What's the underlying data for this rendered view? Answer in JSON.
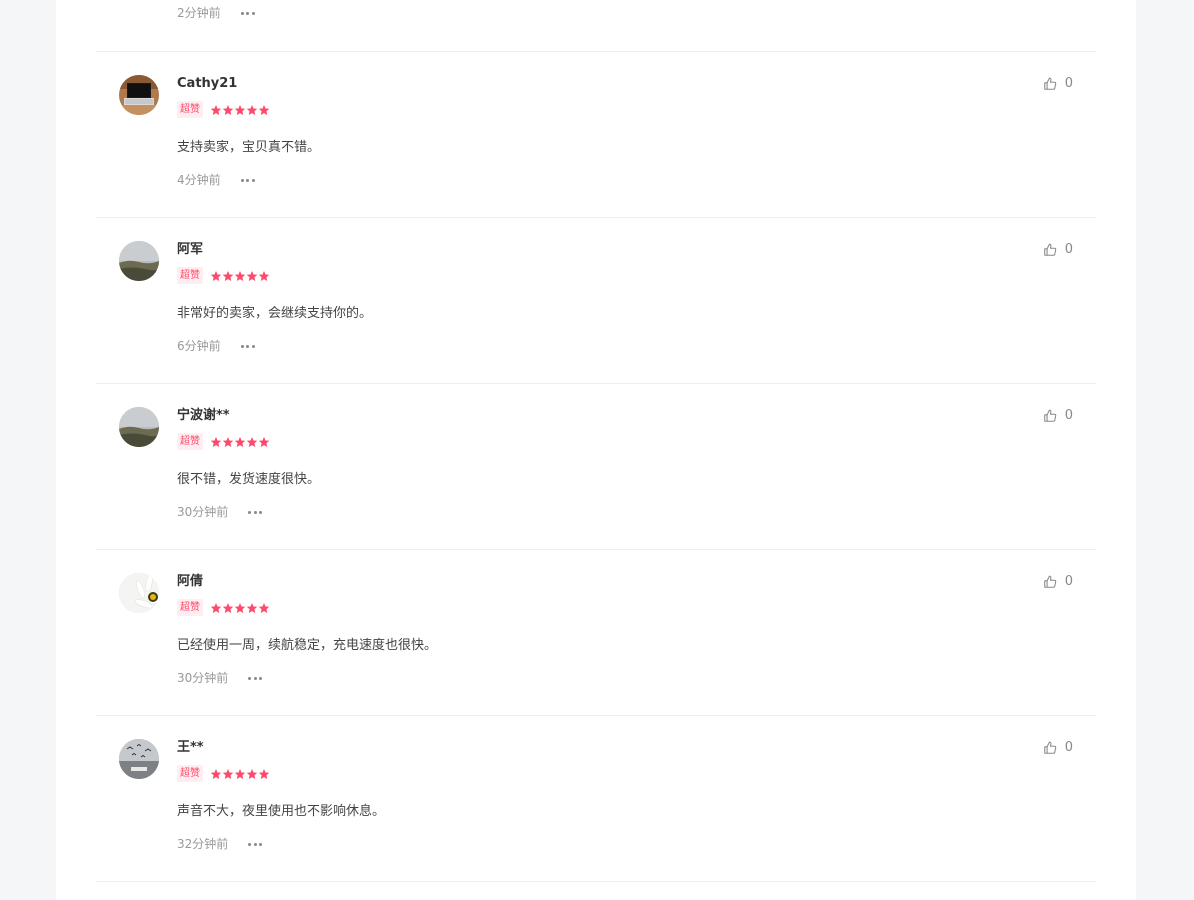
{
  "top_partial": {
    "time": "2分钟前"
  },
  "reviews": [
    {
      "username": "Cathy21",
      "badge": "超赞",
      "rating": 5,
      "content": "支持卖家，宝贝真不错。",
      "time": "4分钟前",
      "likes": "0",
      "avatar": "laptop-avatar"
    },
    {
      "username": "阿军",
      "badge": "超赞",
      "rating": 5,
      "content": "非常好的卖家，会继续支持你的。",
      "time": "6分钟前",
      "likes": "0",
      "avatar": "landscape-avatar"
    },
    {
      "username": "宁波谢**",
      "badge": "超赞",
      "rating": 5,
      "content": "很不错，发货速度很快。",
      "time": "30分钟前",
      "likes": "0",
      "avatar": "landscape-avatar"
    },
    {
      "username": "阿倩",
      "badge": "超赞",
      "rating": 5,
      "content": "已经使用一周，续航稳定，充电速度也很快。",
      "time": "30分钟前",
      "likes": "0",
      "avatar": "flower-avatar"
    },
    {
      "username": "王**",
      "badge": "超赞",
      "rating": 5,
      "content": "声音不大，夜里使用也不影响休息。",
      "time": "32分钟前",
      "likes": "0",
      "avatar": "birds-avatar"
    }
  ],
  "colors": {
    "accent": "#ff4a6b",
    "badge_bg": "#ffeef1",
    "divider": "#eeeeee",
    "page_bg": "#f5f6f8"
  }
}
